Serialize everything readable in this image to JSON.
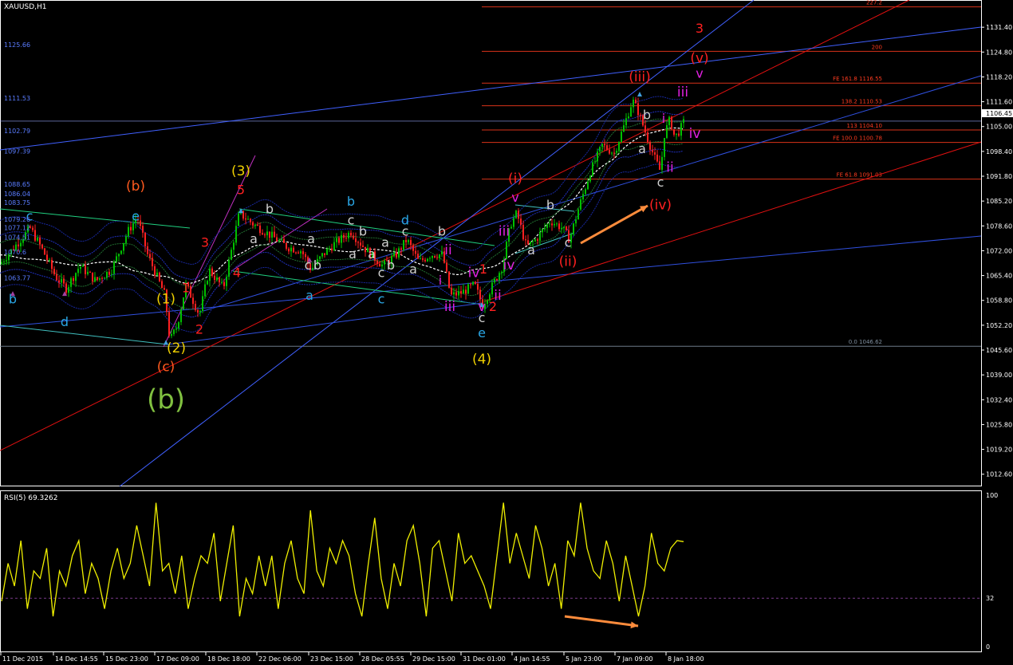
{
  "window": {
    "title": "XAUUSD,H1",
    "colors": {
      "background": "#000000",
      "panel_border": "#ffffff",
      "grid": "#4a4a4a"
    }
  },
  "chart_data": [
    {
      "type": "candlestick",
      "title": "XAUUSD,H1",
      "symbol": "XAUUSD",
      "timeframe": "H1",
      "ylim": [
        1010.0,
        1138.0
      ],
      "yticks": [
        "1131.40",
        "1124.80",
        "1118.20",
        "1111.60",
        "1105.00",
        "1098.40",
        "1091.80",
        "1085.20",
        "1078.60",
        "1072.00",
        "1065.40",
        "1058.80",
        "1052.20",
        "1045.60",
        "1039.00",
        "1032.40",
        "1025.80",
        "1019.20",
        "1012.60"
      ],
      "current_price_label": "1106.45",
      "xticks": [
        "11 Dec 2015",
        "14 Dec 14:55",
        "15 Dec 23:00",
        "17 Dec 09:00",
        "18 Dec 18:00",
        "22 Dec 06:00",
        "23 Dec 15:00",
        "28 Dec 05:55",
        "29 Dec 15:00",
        "31 Dec 01:00",
        "4 Jan 14:55",
        "5 Jan 23:00",
        "7 Jan 09:00",
        "8 Jan 18:00"
      ],
      "price_path": [
        {
          "x": 0,
          "y": 1068.5
        },
        {
          "x": 8,
          "y": 1070.5
        },
        {
          "x": 20,
          "y": 1073.5
        },
        {
          "x": 38,
          "y": 1078
        },
        {
          "x": 55,
          "y": 1071.5
        },
        {
          "x": 70,
          "y": 1065
        },
        {
          "x": 83,
          "y": 1062
        },
        {
          "x": 100,
          "y": 1068
        },
        {
          "x": 120,
          "y": 1064
        },
        {
          "x": 140,
          "y": 1067
        },
        {
          "x": 160,
          "y": 1077
        },
        {
          "x": 172,
          "y": 1081
        },
        {
          "x": 185,
          "y": 1071
        },
        {
          "x": 197,
          "y": 1065
        },
        {
          "x": 207,
          "y": 1060
        },
        {
          "x": 213,
          "y": 1048
        },
        {
          "x": 222,
          "y": 1052
        },
        {
          "x": 233,
          "y": 1063
        },
        {
          "x": 250,
          "y": 1055
        },
        {
          "x": 262,
          "y": 1067
        },
        {
          "x": 280,
          "y": 1062
        },
        {
          "x": 300,
          "y": 1082
        },
        {
          "x": 318,
          "y": 1079
        },
        {
          "x": 340,
          "y": 1076
        },
        {
          "x": 360,
          "y": 1073
        },
        {
          "x": 378,
          "y": 1072
        },
        {
          "x": 390,
          "y": 1067
        },
        {
          "x": 405,
          "y": 1071
        },
        {
          "x": 420,
          "y": 1074
        },
        {
          "x": 440,
          "y": 1077
        },
        {
          "x": 460,
          "y": 1072
        },
        {
          "x": 480,
          "y": 1068
        },
        {
          "x": 497,
          "y": 1071
        },
        {
          "x": 510,
          "y": 1075
        },
        {
          "x": 525,
          "y": 1069
        },
        {
          "x": 540,
          "y": 1071
        },
        {
          "x": 555,
          "y": 1071
        },
        {
          "x": 565,
          "y": 1060
        },
        {
          "x": 580,
          "y": 1061
        },
        {
          "x": 595,
          "y": 1063
        },
        {
          "x": 605,
          "y": 1057.5
        },
        {
          "x": 618,
          "y": 1063
        },
        {
          "x": 630,
          "y": 1068
        },
        {
          "x": 640,
          "y": 1079
        },
        {
          "x": 648,
          "y": 1082
        },
        {
          "x": 660,
          "y": 1073
        },
        {
          "x": 672,
          "y": 1075
        },
        {
          "x": 690,
          "y": 1080
        },
        {
          "x": 705,
          "y": 1078
        },
        {
          "x": 714,
          "y": 1075
        },
        {
          "x": 725,
          "y": 1083
        },
        {
          "x": 740,
          "y": 1093
        },
        {
          "x": 755,
          "y": 1100
        },
        {
          "x": 770,
          "y": 1098
        },
        {
          "x": 782,
          "y": 1105
        },
        {
          "x": 793,
          "y": 1112
        },
        {
          "x": 800,
          "y": 1109
        },
        {
          "x": 810,
          "y": 1103
        },
        {
          "x": 820,
          "y": 1097
        },
        {
          "x": 828,
          "y": 1093
        },
        {
          "x": 833,
          "y": 1103
        },
        {
          "x": 840,
          "y": 1107
        },
        {
          "x": 846,
          "y": 1102
        },
        {
          "x": 852,
          "y": 1104
        },
        {
          "x": 857,
          "y": 1106
        }
      ],
      "levels": [
        {
          "label": "227.2",
          "price": 1136.8,
          "color": "#ff3b1f"
        },
        {
          "label": "200",
          "price": 1125.0,
          "color": "#ff3b1f"
        },
        {
          "label": "FE 161.8 1116.55",
          "price": 1116.55,
          "color": "#ff3b1f"
        },
        {
          "label": "138.2 1110.53",
          "price": 1110.53,
          "color": "#ff3b1f"
        },
        {
          "label": "113 1104.10",
          "price": 1104.1,
          "color": "#ff3b1f"
        },
        {
          "label": "FE 100.0 1100.78",
          "price": 1100.78,
          "color": "#ff3b1f"
        },
        {
          "label": "FE 61.8 1091.03",
          "price": 1091.03,
          "color": "#ff3b1f"
        },
        {
          "label": "0.0 1046.62",
          "price": 1046.62,
          "color": "#8090a0"
        }
      ],
      "left_levels": [
        "1125.66",
        "1111.53",
        "1102.79",
        "1097.39",
        "1088.65",
        "1086.04",
        "1083.75",
        "1079.26",
        "1077.12",
        "1074.51",
        "1070.6",
        "1063.77"
      ],
      "wave_labels": [
        {
          "text": "b",
          "color": "#2aa7e6",
          "x": 16,
          "y": 1058
        },
        {
          "text": "c",
          "color": "#2aa7e6",
          "x": 37,
          "y": 1080
        },
        {
          "text": "d",
          "color": "#2aa7e6",
          "x": 81,
          "y": 1052
        },
        {
          "text": "(b)",
          "color": "#ff5a1e",
          "x": 170,
          "y": 1088
        },
        {
          "text": "e",
          "color": "#2aa7e6",
          "x": 170,
          "y": 1080
        },
        {
          "text": "(1)",
          "color": "#f0d000",
          "x": 208,
          "y": 1058
        },
        {
          "text": "1",
          "color": "#ff2020",
          "x": 233,
          "y": 1061
        },
        {
          "text": "2",
          "color": "#ff2020",
          "x": 250,
          "y": 1050
        },
        {
          "text": "3",
          "color": "#ff2020",
          "x": 257,
          "y": 1073
        },
        {
          "text": "4",
          "color": "#ff2020",
          "x": 297,
          "y": 1065
        },
        {
          "text": "5",
          "color": "#ff2020",
          "x": 302,
          "y": 1087
        },
        {
          "text": "(3)",
          "color": "#f0d000",
          "x": 302,
          "y": 1092
        },
        {
          "text": "(2)",
          "color": "#f0d000",
          "x": 221,
          "y": 1045
        },
        {
          "text": "(c)",
          "color": "#ff5a1e",
          "x": 208,
          "y": 1040
        },
        {
          "text": "(b)",
          "color": "#80c040",
          "x": 208,
          "y": 1030
        },
        {
          "text": "b",
          "color": "#2aa7e6",
          "x": 440,
          "y": 1084
        },
        {
          "text": "d",
          "color": "#2aa7e6",
          "x": 508,
          "y": 1079
        },
        {
          "text": "a",
          "color": "#2aa7e6",
          "x": 388,
          "y": 1059
        },
        {
          "text": "c",
          "color": "#2aa7e6",
          "x": 478,
          "y": 1058
        },
        {
          "text": "e",
          "color": "#2aa7e6",
          "x": 604,
          "y": 1049
        },
        {
          "text": "(4)",
          "color": "#f0d000",
          "x": 604,
          "y": 1042
        },
        {
          "text": "c",
          "color": "#d0d0d0",
          "x": 604,
          "y": 1053
        },
        {
          "text": "v",
          "color": "#e020e0",
          "x": 604,
          "y": 1056
        },
        {
          "text": "2",
          "color": "#ff2020",
          "x": 618,
          "y": 1056
        },
        {
          "text": "1",
          "color": "#ff2020",
          "x": 606,
          "y": 1066
        },
        {
          "text": "iii",
          "color": "#e020e0",
          "x": 564,
          "y": 1056
        },
        {
          "text": "iv",
          "color": "#e020e0",
          "x": 594,
          "y": 1065
        },
        {
          "text": "ii",
          "color": "#e020e0",
          "x": 562,
          "y": 1071
        },
        {
          "text": "i",
          "color": "#e020e0",
          "x": 552,
          "y": 1063
        },
        {
          "text": "ii",
          "color": "#e020e0",
          "x": 624,
          "y": 1059
        },
        {
          "text": "iv",
          "color": "#e020e0",
          "x": 638,
          "y": 1067
        },
        {
          "text": "iii",
          "color": "#e020e0",
          "x": 632,
          "y": 1076
        },
        {
          "text": "v",
          "color": "#e020e0",
          "x": 646,
          "y": 1085
        },
        {
          "text": "(i)",
          "color": "#ff2020",
          "x": 646,
          "y": 1090
        },
        {
          "text": "(ii)",
          "color": "#ff2020",
          "x": 712,
          "y": 1068
        },
        {
          "text": "(iii)",
          "color": "#ff2020",
          "x": 802,
          "y": 1117
        },
        {
          "text": "(iv)",
          "color": "#ff2020",
          "x": 828,
          "y": 1083
        },
        {
          "text": "(v)",
          "color": "#ff2020",
          "x": 877,
          "y": 1122
        },
        {
          "text": "3",
          "color": "#ff2020",
          "x": 877,
          "y": 1130
        },
        {
          "text": "v",
          "color": "#e020e0",
          "x": 877,
          "y": 1118
        },
        {
          "text": "iii",
          "color": "#e020e0",
          "x": 856,
          "y": 1113
        },
        {
          "text": "i",
          "color": "#e020e0",
          "x": 832,
          "y": 1106
        },
        {
          "text": "iv",
          "color": "#e020e0",
          "x": 871,
          "y": 1102
        },
        {
          "text": "ii",
          "color": "#e020e0",
          "x": 840,
          "y": 1093
        },
        {
          "text": "c",
          "color": "#d0d0d0",
          "x": 828,
          "y": 1089
        },
        {
          "text": "b",
          "color": "#d0d0d0",
          "x": 811,
          "y": 1107
        },
        {
          "text": "a",
          "color": "#d0d0d0",
          "x": 805,
          "y": 1098
        },
        {
          "text": "b",
          "color": "#d0d0d0",
          "x": 690,
          "y": 1083
        },
        {
          "text": "a",
          "color": "#d0d0d0",
          "x": 666,
          "y": 1071
        },
        {
          "text": "c",
          "color": "#d0d0d0",
          "x": 712,
          "y": 1073
        },
        {
          "text": "b",
          "color": "#d0d0d0",
          "x": 338,
          "y": 1082
        },
        {
          "text": "a",
          "color": "#d0d0d0",
          "x": 318,
          "y": 1074
        },
        {
          "text": "a",
          "color": "#d0d0d0",
          "x": 390,
          "y": 1074
        },
        {
          "text": "c",
          "color": "#d0d0d0",
          "x": 386,
          "y": 1067
        },
        {
          "text": "b",
          "color": "#d0d0d0",
          "x": 398,
          "y": 1067
        },
        {
          "text": "a",
          "color": "#d0d0d0",
          "x": 442,
          "y": 1070
        },
        {
          "text": "c",
          "color": "#d0d0d0",
          "x": 440,
          "y": 1079
        },
        {
          "text": "b",
          "color": "#d0d0d0",
          "x": 455,
          "y": 1076
        },
        {
          "text": "a",
          "color": "#d0d0d0",
          "x": 466,
          "y": 1070
        },
        {
          "text": "b",
          "color": "#d0d0d0",
          "x": 490,
          "y": 1067
        },
        {
          "text": "c",
          "color": "#d0d0d0",
          "x": 478,
          "y": 1065
        },
        {
          "text": "a",
          "color": "#d0d0d0",
          "x": 483,
          "y": 1073
        },
        {
          "text": "c",
          "color": "#d0d0d0",
          "x": 508,
          "y": 1076
        },
        {
          "text": "a",
          "color": "#d0d0d0",
          "x": 518,
          "y": 1066
        },
        {
          "text": "b",
          "color": "#d0d0d0",
          "x": 554,
          "y": 1076
        }
      ]
    },
    {
      "type": "line",
      "title": "RSI(5) 69.3262",
      "indicator": "RSI",
      "period": 5,
      "last_value": 69.3262,
      "ylim": [
        0,
        100
      ],
      "yticks": [
        "100",
        "32",
        "0"
      ],
      "level": 32,
      "values": [
        30,
        55,
        40,
        70,
        25,
        50,
        45,
        65,
        20,
        50,
        40,
        60,
        70,
        35,
        55,
        45,
        25,
        50,
        65,
        45,
        55,
        80,
        60,
        40,
        95,
        50,
        55,
        35,
        60,
        25,
        45,
        60,
        55,
        75,
        30,
        55,
        80,
        20,
        45,
        35,
        60,
        40,
        60,
        25,
        55,
        70,
        45,
        35,
        90,
        50,
        40,
        65,
        55,
        70,
        60,
        35,
        20,
        55,
        85,
        45,
        25,
        55,
        40,
        70,
        80,
        55,
        20,
        65,
        70,
        50,
        30,
        75,
        55,
        60,
        50,
        40,
        25,
        60,
        95,
        55,
        75,
        60,
        45,
        80,
        65,
        40,
        55,
        25,
        70,
        60,
        95,
        65,
        50,
        45,
        70,
        55,
        30,
        60,
        40,
        20,
        40,
        75,
        55,
        50,
        65,
        70,
        69.3
      ]
    }
  ],
  "annotations": {
    "price_arrow": {
      "from": [
        728,
        305
      ],
      "to": [
        812,
        258
      ],
      "color": "#ff8c3c"
    },
    "rsi_arrow": {
      "from": [
        708,
        773
      ],
      "to": [
        800,
        785
      ],
      "color": "#ff8c3c"
    }
  }
}
